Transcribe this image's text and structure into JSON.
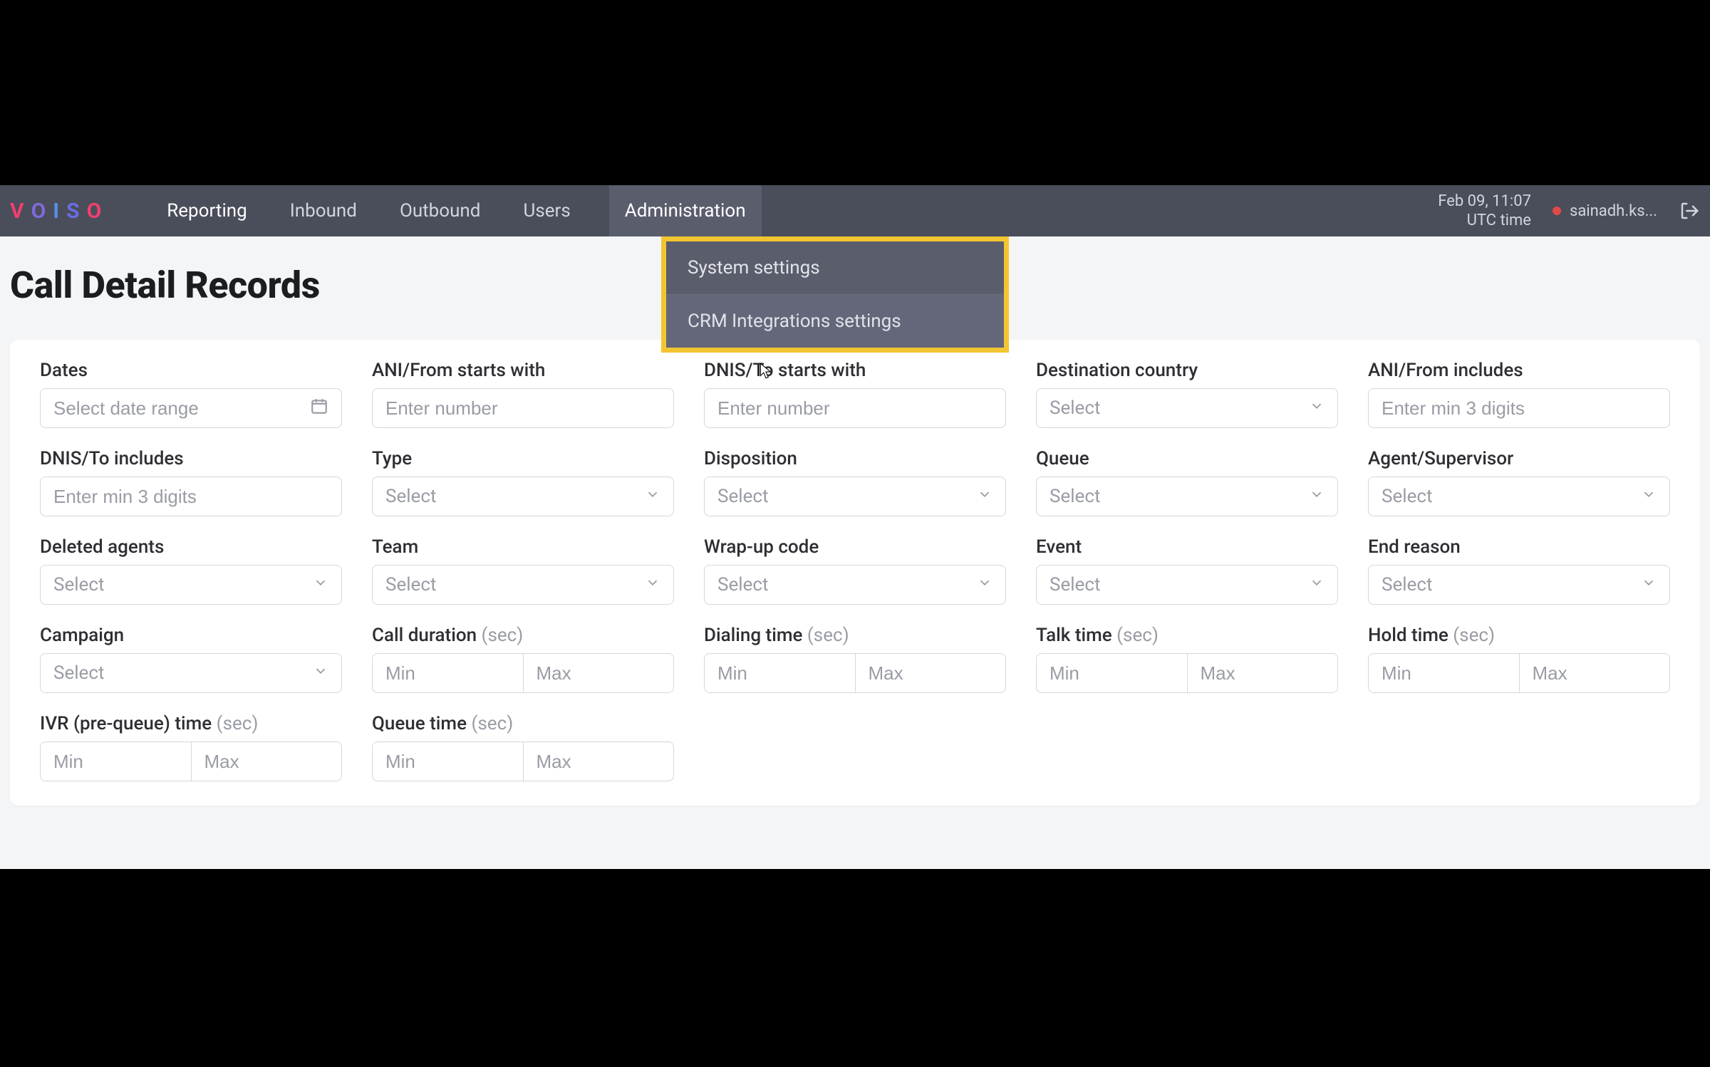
{
  "brand": {
    "letters": [
      "V",
      "O",
      "I",
      "S",
      "O"
    ]
  },
  "nav": {
    "reporting": "Reporting",
    "inbound": "Inbound",
    "outbound": "Outbound",
    "users": "Users",
    "administration": "Administration"
  },
  "admin_menu": {
    "system_settings": "System settings",
    "crm_integrations": "CRM Integrations settings"
  },
  "header_right": {
    "date": "Feb 09, 11:07",
    "tz": "UTC time",
    "username": "sainadh.ks..."
  },
  "page": {
    "title": "Call Detail Records"
  },
  "filters": {
    "dates": {
      "label": "Dates",
      "placeholder": "Select date range"
    },
    "ani_starts": {
      "label": "ANI/From starts with",
      "placeholder": "Enter number"
    },
    "dnis_starts": {
      "label": "DNIS/To starts with",
      "placeholder": "Enter number"
    },
    "dest_country": {
      "label": "Destination country",
      "placeholder": "Select"
    },
    "ani_includes": {
      "label": "ANI/From includes",
      "placeholder": "Enter min 3 digits"
    },
    "dnis_includes": {
      "label": "DNIS/To includes",
      "placeholder": "Enter min 3 digits"
    },
    "type": {
      "label": "Type",
      "placeholder": "Select"
    },
    "disposition": {
      "label": "Disposition",
      "placeholder": "Select"
    },
    "queue": {
      "label": "Queue",
      "placeholder": "Select"
    },
    "agent": {
      "label": "Agent/Supervisor",
      "placeholder": "Select"
    },
    "deleted_agents": {
      "label": "Deleted agents",
      "placeholder": "Select"
    },
    "team": {
      "label": "Team",
      "placeholder": "Select"
    },
    "wrapup": {
      "label": "Wrap-up code",
      "placeholder": "Select"
    },
    "event": {
      "label": "Event",
      "placeholder": "Select"
    },
    "end_reason": {
      "label": "End reason",
      "placeholder": "Select"
    },
    "campaign": {
      "label": "Campaign",
      "placeholder": "Select"
    },
    "call_duration": {
      "label": "Call duration",
      "unit": "(sec)",
      "min": "Min",
      "max": "Max"
    },
    "dialing_time": {
      "label": "Dialing time",
      "unit": "(sec)",
      "min": "Min",
      "max": "Max"
    },
    "talk_time": {
      "label": "Talk time",
      "unit": "(sec)",
      "min": "Min",
      "max": "Max"
    },
    "hold_time": {
      "label": "Hold time",
      "unit": "(sec)",
      "min": "Min",
      "max": "Max"
    },
    "ivr_time": {
      "label": "IVR (pre-queue) time",
      "unit": "(sec)",
      "min": "Min",
      "max": "Max"
    },
    "queue_time": {
      "label": "Queue time",
      "unit": "(sec)",
      "min": "Min",
      "max": "Max"
    }
  }
}
